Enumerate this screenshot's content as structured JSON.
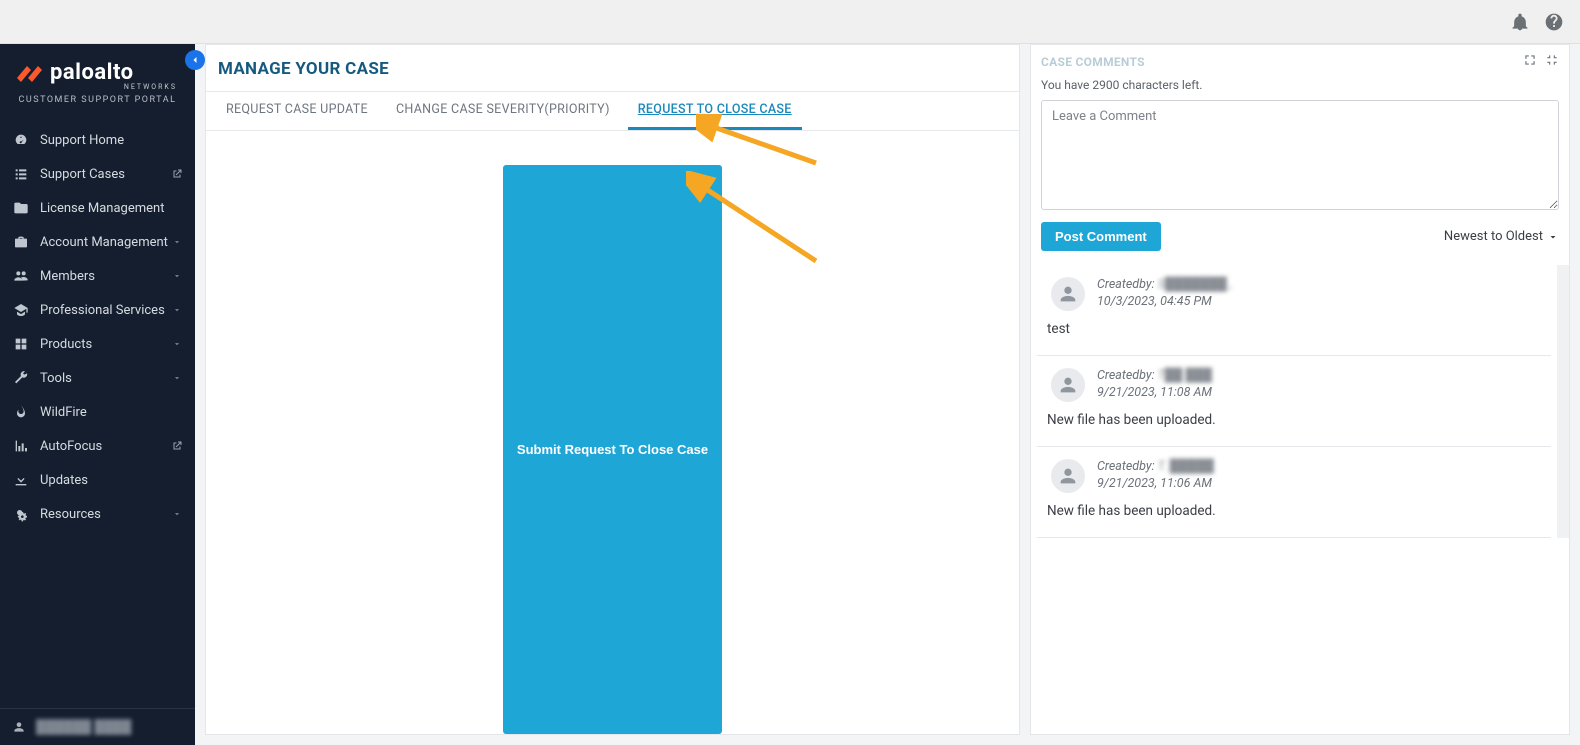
{
  "brand": {
    "company": "paloalto",
    "networks": "NETWORKS",
    "portal": "CUSTOMER SUPPORT PORTAL"
  },
  "sidebar": {
    "items": [
      {
        "label": "Support Home",
        "ext": false,
        "chev": false
      },
      {
        "label": "Support Cases",
        "ext": true,
        "chev": false
      },
      {
        "label": "License Management",
        "ext": false,
        "chev": false
      },
      {
        "label": "Account Management",
        "ext": false,
        "chev": true
      },
      {
        "label": "Members",
        "ext": false,
        "chev": true
      },
      {
        "label": "Professional Services",
        "ext": false,
        "chev": true
      },
      {
        "label": "Products",
        "ext": false,
        "chev": true
      },
      {
        "label": "Tools",
        "ext": false,
        "chev": true
      },
      {
        "label": "WildFire",
        "ext": false,
        "chev": false
      },
      {
        "label": "AutoFocus",
        "ext": true,
        "chev": false
      },
      {
        "label": "Updates",
        "ext": false,
        "chev": false
      },
      {
        "label": "Resources",
        "ext": false,
        "chev": true
      }
    ],
    "user_masked": "██████  ████"
  },
  "main": {
    "title": "MANAGE YOUR CASE",
    "tabs": [
      {
        "label": "REQUEST CASE UPDATE"
      },
      {
        "label": "CHANGE CASE SEVERITY(PRIORITY)"
      },
      {
        "label": "REQUEST TO CLOSE CASE",
        "active": true
      }
    ],
    "submit_label": "Submit Request To Close Case"
  },
  "panel": {
    "header": "CASE COMMENTS",
    "char_note": "You have 2900 characters left.",
    "comment_placeholder": "Leave a Comment",
    "post_label": "Post Comment",
    "sort_label": "Newest to Oldest",
    "comments": [
      {
        "created_label": "Createdby:",
        "author_masked": "S███████  ,",
        "timestamp": "10/3/2023, 04:45 PM",
        "body": "test"
      },
      {
        "created_label": "Createdby:",
        "author_masked": "T██ ███",
        "timestamp": "9/21/2023, 11:08 AM",
        "body": "New file has been uploaded."
      },
      {
        "created_label": "Createdby:",
        "author_masked": "T. █████",
        "timestamp": "9/21/2023, 11:06 AM",
        "body": "New file has been uploaded."
      }
    ]
  }
}
